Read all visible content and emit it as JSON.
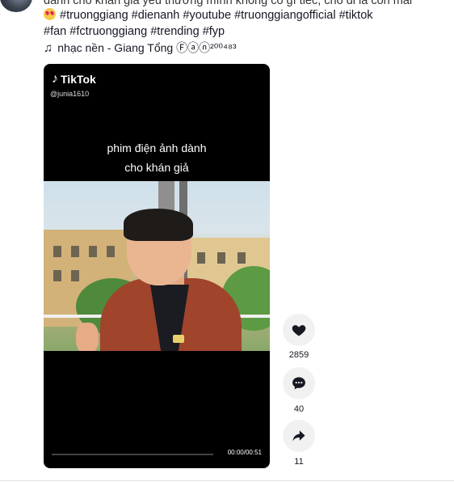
{
  "post": {
    "description_cut_line": "dành cho khán giả yêu thương mình không có gì tiếc, cho đi là còn mãi",
    "hashtags_line1": "#truonggiang #dienanh #youtube #truonggiangofficial #tiktok",
    "hashtags_line2": "#fan #fctruonggiang #trending #fyp",
    "emoji_icon": "smiling-face-with-heart-eyes",
    "music_icon": "music-note-icon",
    "music_label": "nhạc nền - Giang Tổng Ⓕⓐⓝ²⁰⁰⁴⁸³"
  },
  "video": {
    "logo_text": "TikTok",
    "username": "@junia1610",
    "caption_line1": "phim điện ảnh dành",
    "caption_line2": "cho khán giả",
    "time": "00:00/00:51",
    "progress": 0
  },
  "actions": {
    "like": {
      "icon": "heart-icon",
      "count": "2859"
    },
    "comment": {
      "icon": "comment-icon",
      "count": "40"
    },
    "share": {
      "icon": "share-icon",
      "count": "11"
    }
  },
  "colors": {
    "text": "#161823",
    "action_bg": "#f1f1f2",
    "player_bg": "#000000"
  }
}
